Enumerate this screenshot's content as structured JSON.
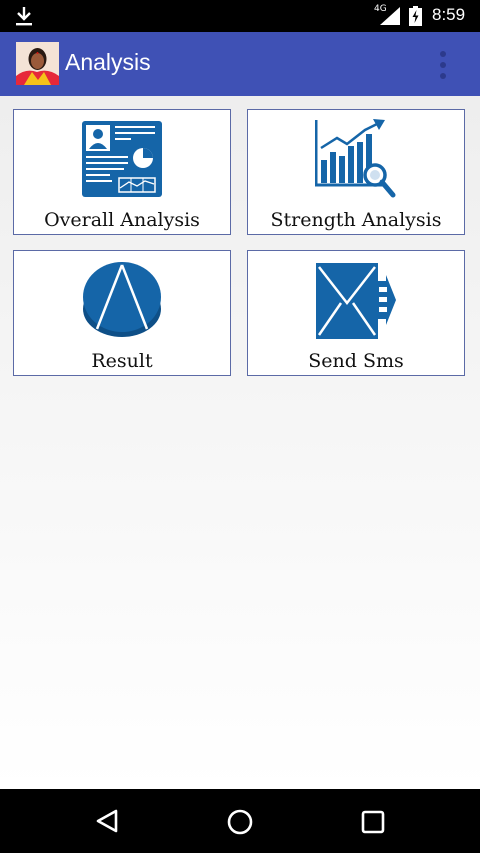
{
  "status_bar": {
    "network_type": "4G",
    "time": "8:59",
    "icons": [
      "download-icon",
      "signal-icon",
      "battery-charging-icon"
    ]
  },
  "app_bar": {
    "title": "Analysis",
    "avatar_icon": "profile-avatar",
    "overflow_icon": "more-vert-icon"
  },
  "tiles": [
    {
      "label": "Overall Analysis",
      "icon": "profile-card-icon"
    },
    {
      "label": "Strength Analysis",
      "icon": "bar-chart-magnifier-icon"
    },
    {
      "label": "Result",
      "icon": "pie-chart-icon"
    },
    {
      "label": "Send Sms",
      "icon": "envelope-send-icon"
    }
  ],
  "nav_bar": {
    "icons": [
      "back-icon",
      "home-icon",
      "recents-icon"
    ]
  },
  "colors": {
    "app_bar": "#3f51b5",
    "icon_blue": "#1565a8",
    "tile_border": "#5b6aa6"
  }
}
